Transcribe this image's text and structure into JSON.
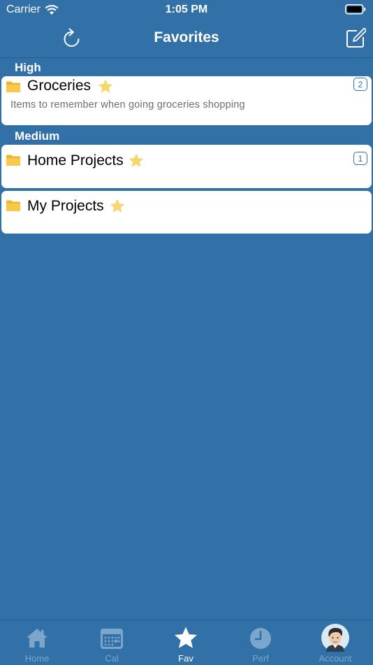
{
  "status_bar": {
    "carrier": "Carrier",
    "time": "1:05 PM"
  },
  "nav": {
    "title": "Favorites"
  },
  "sections": [
    {
      "header": "High"
    },
    {
      "header": "Medium"
    }
  ],
  "cards": [
    {
      "title": "Groceries",
      "description": "Items to remember when going groceries shopping",
      "badge": "2"
    },
    {
      "title": "Home Projects",
      "description": "",
      "badge": "1"
    },
    {
      "title": "My Projects",
      "description": "",
      "badge": ""
    }
  ],
  "tabs": [
    {
      "label": "Home",
      "icon": "home-icon"
    },
    {
      "label": "Cal",
      "icon": "calendar-icon"
    },
    {
      "label": "Fav",
      "icon": "star-icon"
    },
    {
      "label": "Perf",
      "icon": "clock-icon"
    },
    {
      "label": "Account",
      "icon": "avatar-icon"
    }
  ],
  "active_tab": "Fav",
  "colors": {
    "background": "#3271a8",
    "star": "#f5d76e",
    "folder": "#f0b429",
    "inactive_tab": "#7aa6cc"
  }
}
